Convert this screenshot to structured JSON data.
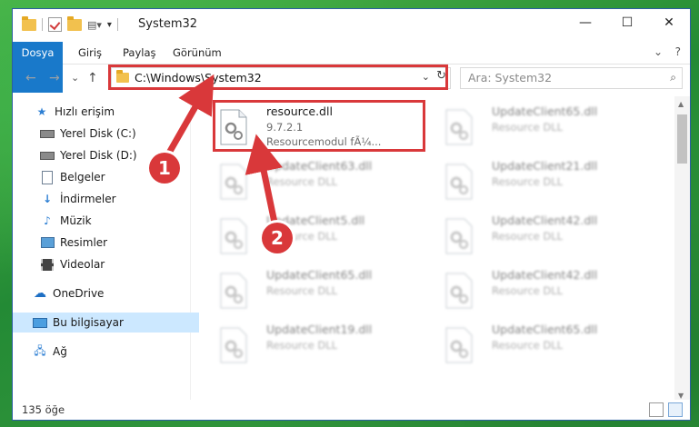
{
  "window": {
    "title": "System32"
  },
  "window_buttons": {
    "minimize": "—",
    "maximize": "☐",
    "close": "✕"
  },
  "ribbon": {
    "tabs": [
      "Dosya",
      "Giriş",
      "Paylaş",
      "Görünüm"
    ]
  },
  "nav": {
    "back": "←",
    "forward": "→",
    "recent": "⌄",
    "up": "↑"
  },
  "address": {
    "path": "C:\\Windows\\System32",
    "dropdown": "⌄",
    "refresh": "↻"
  },
  "search": {
    "placeholder": "Ara: System32"
  },
  "sidebar": {
    "items": [
      {
        "label": "Hızlı erişim",
        "icon": "star-icon",
        "pinned": false
      },
      {
        "label": "Yerel Disk (C:)",
        "icon": "drive-icon",
        "pinned": false
      },
      {
        "label": "Yerel Disk (D:)",
        "icon": "drive-icon",
        "pinned": false
      },
      {
        "label": "Belgeler",
        "icon": "documents-icon",
        "pinned": false
      },
      {
        "label": "İndirmeler",
        "icon": "downloads-icon",
        "pinned": true
      },
      {
        "label": "Müzik",
        "icon": "music-icon",
        "pinned": true
      },
      {
        "label": "Resimler",
        "icon": "pictures-icon",
        "pinned": true
      },
      {
        "label": "Videolar",
        "icon": "videos-icon",
        "pinned": true
      },
      {
        "label": "OneDrive",
        "icon": "onedrive-icon",
        "pinned": false
      },
      {
        "label": "Bu bilgisayar",
        "icon": "this-pc-icon",
        "pinned": false,
        "selected": true
      },
      {
        "label": "Ağ",
        "icon": "network-icon",
        "pinned": false
      }
    ]
  },
  "files": [
    {
      "name": "resource.dll",
      "line2": "9.7.2.1",
      "line3": "Resourcemodul fÃ¼...",
      "highlighted": true
    },
    {
      "name": "UpdateClient65.dll",
      "line2": "Resource DLL"
    },
    {
      "name": "UpdateClient63.dll",
      "line2": "Resource DLL"
    },
    {
      "name": "UpdateClient21.dll",
      "line2": "Resource DLL"
    },
    {
      "name": "UpdateClient5.dll",
      "line2": "Resource DLL"
    },
    {
      "name": "UpdateClient42.dll",
      "line2": "Resource DLL"
    },
    {
      "name": "UpdateClient65.dll",
      "line2": "Resource DLL"
    },
    {
      "name": "UpdateClient42.dll",
      "line2": "Resource DLL"
    },
    {
      "name": "UpdateClient19.dll",
      "line2": "Resource DLL"
    },
    {
      "name": "UpdateClient65.dll",
      "line2": "Resource DLL"
    }
  ],
  "status": {
    "count": "135 öğe"
  },
  "annotations": {
    "step1": "1",
    "step2": "2",
    "color": "#d9383a"
  }
}
